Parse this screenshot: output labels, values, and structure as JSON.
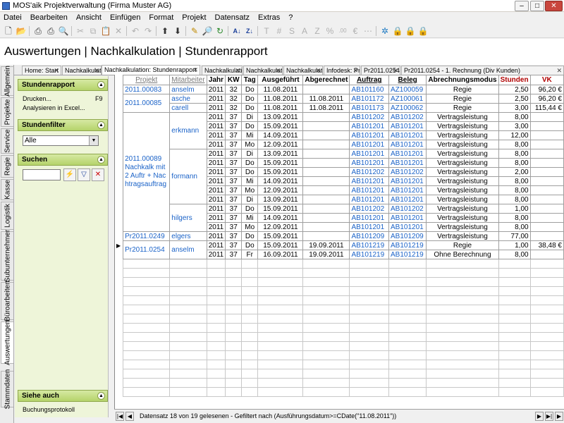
{
  "window": {
    "title": "MOS'aik Projektverwaltung (Firma Muster AG)"
  },
  "menu": [
    "Datei",
    "Bearbeiten",
    "Ansicht",
    "Einfügen",
    "Format",
    "Projekt",
    "Datensatz",
    "Extras",
    "?"
  ],
  "header": {
    "title": "Auswertungen | Nachkalkulation | Stundenrapport"
  },
  "vtabs": [
    "Allgemein",
    "Projekte",
    "Service",
    "Regie",
    "Kasse",
    "Logistik",
    "Subunternehmer",
    "Büroarbeiten",
    "Auswertungen",
    "Stammdaten"
  ],
  "doctabs": [
    "Home: Start",
    "Nachkalkulati",
    "Nachkalkulation: Stundenrapport",
    "Nachkalkulati",
    "Nachkalkulati",
    "Nachkalkulati",
    "Infodesk: Pr",
    "Pr2011.0254",
    "Pr2011.0254 - 1. Rechnung (Div Kunden)"
  ],
  "side": {
    "sec1": "Stundenrapport",
    "print": "Drucken...",
    "print_key": "F9",
    "excel": "Analysieren in Excel...",
    "sec2": "Stundenfilter",
    "filter_value": "Alle",
    "sec3": "Suchen",
    "sec4": "Siehe auch",
    "link": "Buchungsprotokoll"
  },
  "grid": {
    "columns": [
      "Projekt",
      "Mitarbeiter",
      "Jahr",
      "KW",
      "Tag",
      "Ausgeführt",
      "Abgerechnet",
      "Auftrag",
      "Beleg",
      "Abrechnungsmodus",
      "Stunden",
      "VK"
    ],
    "rows": [
      {
        "projekt": "2011.00083",
        "mitarbeiter": "anselm",
        "jahr": "2011",
        "kw": "32",
        "tag": "Do",
        "ausgefuehrt": "11.08.2011",
        "abgerechnet": "",
        "auftrag": "AB101160",
        "beleg": "AZ100059",
        "modus": "Regie",
        "stunden": "2,50",
        "vk": "96,20 €"
      },
      {
        "projekt": "2011.00085",
        "mitarbeiter": "asche",
        "jahr": "2011",
        "kw": "32",
        "tag": "Do",
        "ausgefuehrt": "11.08.2011",
        "abgerechnet": "11.08.2011",
        "auftrag": "AB101172",
        "beleg": "AZ100061",
        "modus": "Regie",
        "stunden": "2,50",
        "vk": "96,20 €"
      },
      {
        "projekt": "",
        "mitarbeiter": "carell",
        "jahr": "2011",
        "kw": "32",
        "tag": "Do",
        "ausgefuehrt": "11.08.2011",
        "abgerechnet": "11.08.2011",
        "auftrag": "AB101173",
        "beleg": "AZ100062",
        "modus": "Regie",
        "stunden": "3,00",
        "vk": "115,44 €"
      },
      {
        "projekt": "",
        "mitarbeiter": "",
        "jahr": "2011",
        "kw": "37",
        "tag": "Di",
        "ausgefuehrt": "13.09.2011",
        "abgerechnet": "",
        "auftrag": "AB101202",
        "beleg": "AB101202",
        "modus": "Vertragsleistung",
        "stunden": "8,00",
        "vk": ""
      },
      {
        "projekt": "",
        "mitarbeiter": "erkmann",
        "jahr": "2011",
        "kw": "37",
        "tag": "Do",
        "ausgefuehrt": "15.09.2011",
        "abgerechnet": "",
        "auftrag": "AB101201",
        "beleg": "AB101201",
        "modus": "Vertragsleistung",
        "stunden": "3,00",
        "vk": ""
      },
      {
        "projekt": "",
        "mitarbeiter": "",
        "jahr": "2011",
        "kw": "37",
        "tag": "Mi",
        "ausgefuehrt": "14.09.2011",
        "abgerechnet": "",
        "auftrag": "AB101201",
        "beleg": "AB101201",
        "modus": "Vertragsleistung",
        "stunden": "12,00",
        "vk": ""
      },
      {
        "projekt": "",
        "mitarbeiter": "",
        "jahr": "2011",
        "kw": "37",
        "tag": "Mo",
        "ausgefuehrt": "12.09.2011",
        "abgerechnet": "",
        "auftrag": "AB101201",
        "beleg": "AB101201",
        "modus": "Vertragsleistung",
        "stunden": "8,00",
        "vk": ""
      },
      {
        "projekt": "",
        "mitarbeiter": "",
        "jahr": "2011",
        "kw": "37",
        "tag": "Di",
        "ausgefuehrt": "13.09.2011",
        "abgerechnet": "",
        "auftrag": "AB101201",
        "beleg": "AB101201",
        "modus": "Vertragsleistung",
        "stunden": "8,00",
        "vk": ""
      },
      {
        "projekt": "",
        "mitarbeiter": "",
        "jahr": "2011",
        "kw": "37",
        "tag": "Do",
        "ausgefuehrt": "15.09.2011",
        "abgerechnet": "",
        "auftrag": "AB101201",
        "beleg": "AB101201",
        "modus": "Vertragsleistung",
        "stunden": "8,00",
        "vk": ""
      },
      {
        "projekt": "",
        "mitarbeiter": "formann",
        "jahr": "2011",
        "kw": "37",
        "tag": "Do",
        "ausgefuehrt": "15.09.2011",
        "abgerechnet": "",
        "auftrag": "AB101202",
        "beleg": "AB101202",
        "modus": "Vertragsleistung",
        "stunden": "2,00",
        "vk": ""
      },
      {
        "projekt": "",
        "mitarbeiter": "",
        "jahr": "2011",
        "kw": "37",
        "tag": "Mi",
        "ausgefuehrt": "14.09.2011",
        "abgerechnet": "",
        "auftrag": "AB101201",
        "beleg": "AB101201",
        "modus": "Vertragsleistung",
        "stunden": "8,00",
        "vk": ""
      },
      {
        "projekt": "",
        "mitarbeiter": "",
        "jahr": "2011",
        "kw": "37",
        "tag": "Mo",
        "ausgefuehrt": "12.09.2011",
        "abgerechnet": "",
        "auftrag": "AB101201",
        "beleg": "AB101201",
        "modus": "Vertragsleistung",
        "stunden": "8,00",
        "vk": ""
      },
      {
        "projekt": "",
        "mitarbeiter": "",
        "jahr": "2011",
        "kw": "37",
        "tag": "Di",
        "ausgefuehrt": "13.09.2011",
        "abgerechnet": "",
        "auftrag": "AB101201",
        "beleg": "AB101201",
        "modus": "Vertragsleistung",
        "stunden": "8,00",
        "vk": ""
      },
      {
        "projekt": "",
        "mitarbeiter": "hilgers",
        "jahr": "2011",
        "kw": "37",
        "tag": "Do",
        "ausgefuehrt": "15.09.2011",
        "abgerechnet": "",
        "auftrag": "AB101202",
        "beleg": "AB101202",
        "modus": "Vertragsleistung",
        "stunden": "1,00",
        "vk": ""
      },
      {
        "projekt": "",
        "mitarbeiter": "",
        "jahr": "2011",
        "kw": "37",
        "tag": "Mi",
        "ausgefuehrt": "14.09.2011",
        "abgerechnet": "",
        "auftrag": "AB101201",
        "beleg": "AB101201",
        "modus": "Vertragsleistung",
        "stunden": "8,00",
        "vk": ""
      },
      {
        "projekt": "",
        "mitarbeiter": "",
        "jahr": "2011",
        "kw": "37",
        "tag": "Mo",
        "ausgefuehrt": "12.09.2011",
        "abgerechnet": "",
        "auftrag": "AB101201",
        "beleg": "AB101201",
        "modus": "Vertragsleistung",
        "stunden": "8,00",
        "vk": ""
      },
      {
        "projekt": "Pr2011.0249",
        "mitarbeiter": "elgers",
        "jahr": "2011",
        "kw": "37",
        "tag": "Do",
        "ausgefuehrt": "15.09.2011",
        "abgerechnet": "",
        "auftrag": "AB101209",
        "beleg": "AB101209",
        "modus": "Vertragsleistung",
        "stunden": "77,00",
        "vk": ""
      },
      {
        "projekt": "",
        "mitarbeiter": "",
        "jahr": "2011",
        "kw": "37",
        "tag": "Do",
        "ausgefuehrt": "15.09.2011",
        "abgerechnet": "19.09.2011",
        "auftrag": "AB101219",
        "beleg": "AB101219",
        "modus": "Regie",
        "stunden": "1,00",
        "vk": "38,48 €"
      },
      {
        "projekt": "",
        "mitarbeiter": "",
        "jahr": "2011",
        "kw": "37",
        "tag": "Fr",
        "ausgefuehrt": "16.09.2011",
        "abgerechnet": "19.09.2011",
        "auftrag": "AB101219",
        "beleg": "AB101219",
        "modus": "Ohne Berechnung",
        "stunden": "8,00",
        "vk": ""
      }
    ],
    "merged": {
      "projekt_2011_00089": "2011.00089 Nachkalk mit 2 Auftr + Nachtragsauftrag",
      "projekt_pr2011_0254": "Pr2011.0254",
      "mitarbeiter_anselm2": "anselm"
    }
  },
  "status": {
    "text": "Datensatz 18 von 19 gelesenen - Gefiltert nach (Ausführungsdatum>=CDate(\"11.08.2011\"))"
  }
}
